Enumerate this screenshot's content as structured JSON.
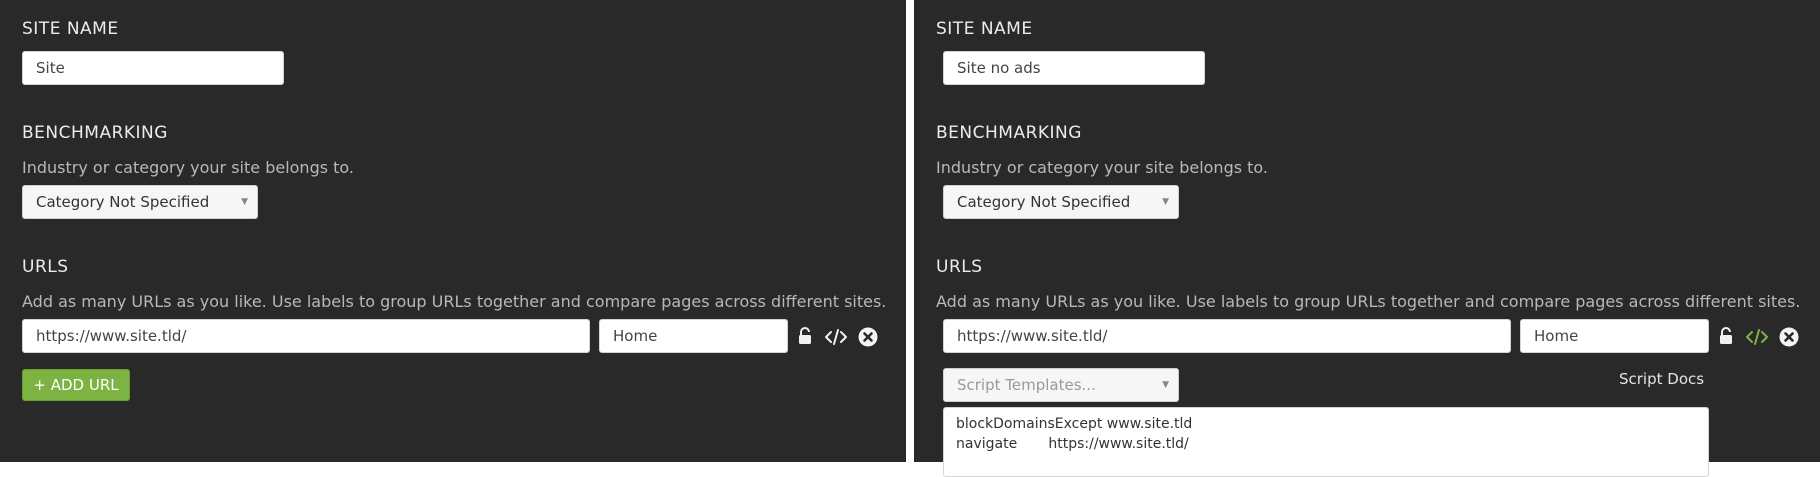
{
  "left": {
    "site_name": {
      "heading": "SITE NAME",
      "value": "Site"
    },
    "benchmarking": {
      "heading": "BENCHMARKING",
      "description": "Industry or category your site belongs to.",
      "category": "Category Not Specified"
    },
    "urls": {
      "heading": "URLS",
      "description": "Add as many URLs as you like. Use labels to group URLs together and compare pages across different sites.",
      "rows": [
        {
          "url": "https://www.site.tld/",
          "label": "Home"
        }
      ],
      "add_button": "+ ADD URL"
    }
  },
  "right": {
    "site_name": {
      "heading": "SITE NAME",
      "value": "Site no ads"
    },
    "benchmarking": {
      "heading": "BENCHMARKING",
      "description": "Industry or category your site belongs to.",
      "category": "Category Not Specified"
    },
    "urls": {
      "heading": "URLS",
      "description": "Add as many URLs as you like. Use labels to group URLs together and compare pages across different sites.",
      "rows": [
        {
          "url": "https://www.site.tld/",
          "label": "Home"
        }
      ]
    },
    "script": {
      "templates_placeholder": "Script Templates...",
      "docs_link": "Script Docs",
      "lines": [
        "blockDomainsExcept www.site.tld",
        "navigate       https://www.site.tld/"
      ]
    }
  },
  "icons": {
    "lock": "unlocked-padlock-icon",
    "code": "code-brackets-icon",
    "remove": "circle-x-icon"
  },
  "colors": {
    "background": "#2a292a",
    "divider": "#ffffff",
    "accent_green": "#7cb342",
    "code_icon_active": "#7cb342"
  }
}
